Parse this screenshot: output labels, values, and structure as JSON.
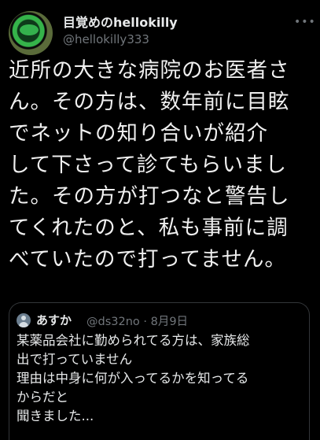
{
  "tweet": {
    "display_name": "目覚めのhellokilly",
    "handle": "@hellokilly333",
    "more_label": "•••",
    "text_lines": [
      "近所の大きな病院のお医者さ",
      "ん。その方は、数年前に目眩",
      "でネットの知り合いが紹介",
      "して下さって診てもらいまし",
      "た。その方が打つなと警告し",
      "てくれたのと、私も事前に調",
      "べていたので打ってません。"
    ]
  },
  "quote": {
    "name": "あすか",
    "handle": "@ds32no",
    "separator": "·",
    "date": "8月9日",
    "body_lines": [
      "某薬品会社に勤められてる方は、家族総",
      "出で打っていません",
      "理由は中身に何が入ってるかを知ってる",
      "からだと",
      "聞きました..."
    ]
  }
}
